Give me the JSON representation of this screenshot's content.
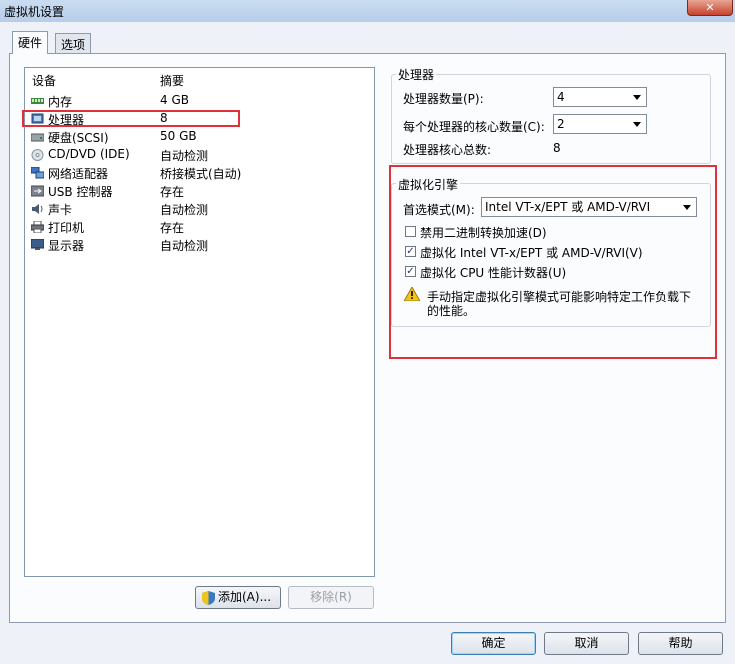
{
  "window": {
    "title": "虚拟机设置",
    "close": "✕"
  },
  "tabs": [
    "硬件",
    "选项"
  ],
  "device_list": {
    "columns": [
      "设备",
      "摘要"
    ],
    "rows": [
      {
        "icon": "memory-icon",
        "name": "内存",
        "summary": "4 GB"
      },
      {
        "icon": "processor-icon",
        "name": "处理器",
        "summary": "8"
      },
      {
        "icon": "disk-icon",
        "name": "硬盘(SCSI)",
        "summary": "50 GB"
      },
      {
        "icon": "cd-dvd-icon",
        "name": "CD/DVD (IDE)",
        "summary": "自动检测"
      },
      {
        "icon": "network-adapter-icon",
        "name": "网络适配器",
        "summary": "桥接模式(自动)"
      },
      {
        "icon": "usb-icon",
        "name": "USB 控制器",
        "summary": "存在"
      },
      {
        "icon": "sound-card-icon",
        "name": "声卡",
        "summary": "自动检测"
      },
      {
        "icon": "printer-icon",
        "name": "打印机",
        "summary": "存在"
      },
      {
        "icon": "display-icon",
        "name": "显示器",
        "summary": "自动检测"
      }
    ],
    "selected_index": 1
  },
  "list_buttons": {
    "add": "添加(A)...",
    "remove": "移除(R)"
  },
  "processor": {
    "group_title": "处理器",
    "count_label": "处理器数量(P):",
    "count_value": "4",
    "cores_label": "每个处理器的核心数量(C):",
    "cores_value": "2",
    "total_label": "处理器核心总数:",
    "total_value": "8"
  },
  "virtualization": {
    "group_title": "虚拟化引擎",
    "mode_label": "首选模式(M):",
    "mode_value": "Intel VT-x/EPT 或 AMD-V/RVI",
    "options": [
      {
        "label": "禁用二进制转换加速(D)",
        "checked": false
      },
      {
        "label": "虚拟化 Intel VT-x/EPT 或 AMD-V/RVI(V)",
        "checked": true
      },
      {
        "label": "虚拟化 CPU 性能计数器(U)",
        "checked": true
      }
    ],
    "warning_line1": "手动指定虚拟化引擎模式可能影响特定工作负载下",
    "warning_line2": "的性能。"
  },
  "footer": {
    "ok": "确定",
    "cancel": "取消",
    "help": "帮助"
  },
  "colors": {
    "highlight": "#e0303a",
    "accent": "#3c7fb1",
    "warning": "#f2c21b"
  }
}
